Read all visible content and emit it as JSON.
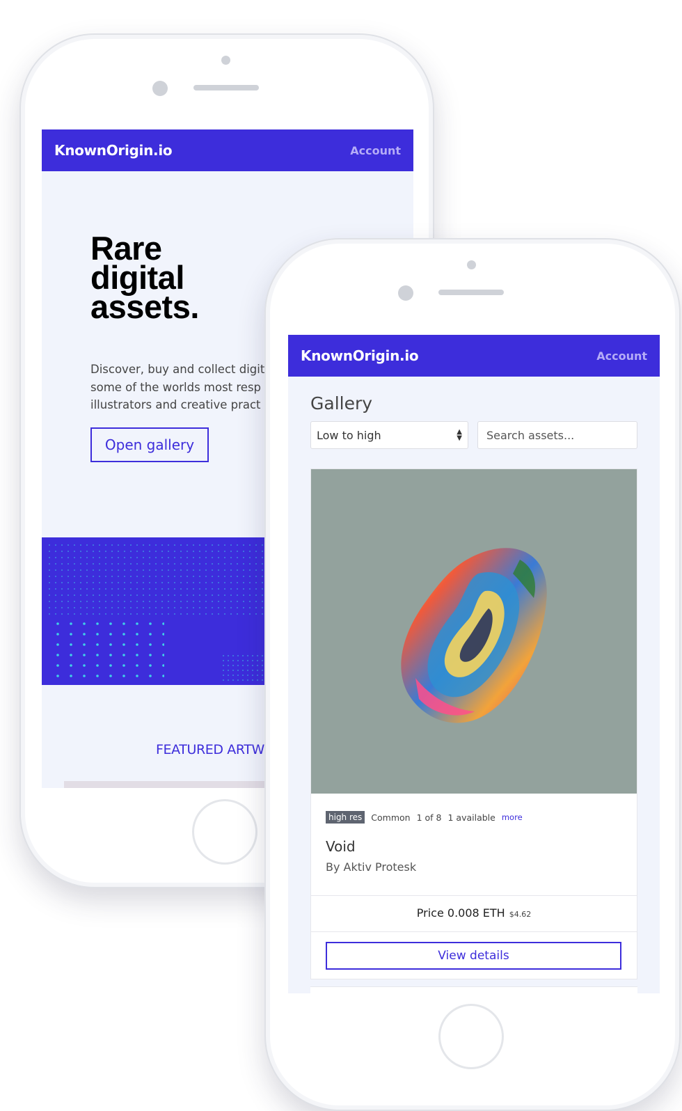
{
  "back_phone": {
    "navbar": {
      "brand": "KnownOrigin.io",
      "account": "Account"
    },
    "hero": {
      "title_lines": [
        "Rare",
        "digital",
        "assets."
      ],
      "description_lines": [
        "Discover, buy and collect digit",
        "some of the worlds most resp",
        "illustrators and creative pract"
      ],
      "cta": "Open gallery"
    },
    "featured": "FEATURED ARTW"
  },
  "front_phone": {
    "navbar": {
      "brand": "KnownOrigin.io",
      "account": "Account"
    },
    "gallery": {
      "title": "Gallery",
      "sort": {
        "selected": "Low to high"
      },
      "search": {
        "placeholder": "Search assets..."
      }
    },
    "card": {
      "tags": {
        "high_res": "high res",
        "rarity": "Common",
        "edition": "1 of 8",
        "available": "1 available",
        "more": "more"
      },
      "title": "Void",
      "artist": "By Aktiv Protesk",
      "price": "Price 0.008 ETH",
      "price_usd": "$4.62",
      "button": "View details"
    }
  },
  "colors": {
    "brand": "#3d2ddb",
    "screen_bg": "#f1f4fc",
    "artwork_bg": "#93a29d"
  }
}
